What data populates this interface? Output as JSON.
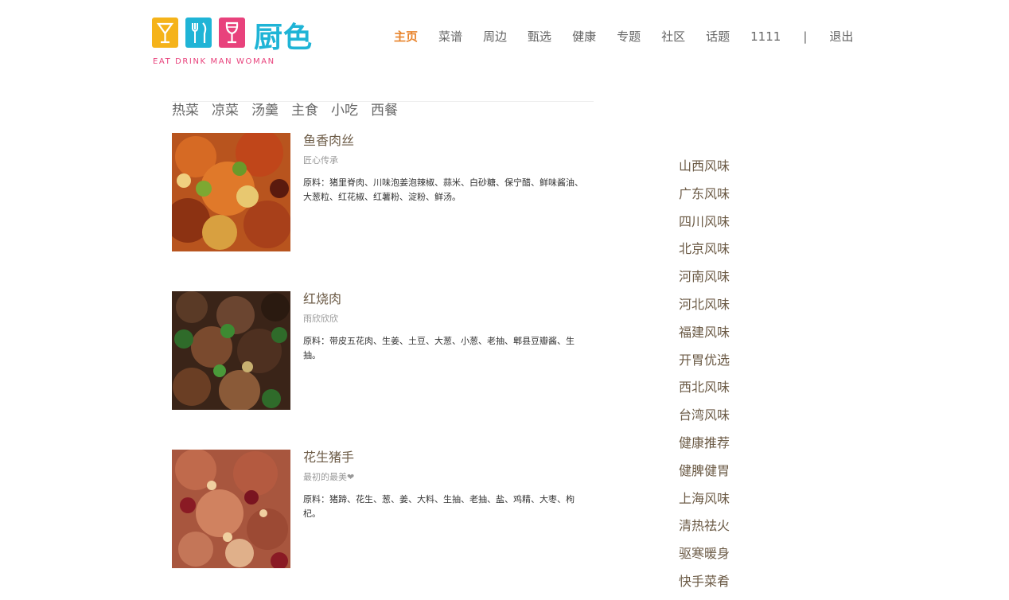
{
  "brand": {
    "name": "厨色",
    "slogan": "EAT DRINK MAN WOMAN",
    "colors": {
      "yellow": "#f5b31a",
      "cyan": "#1fb4d6",
      "pink": "#e8427c"
    },
    "icons": [
      "cocktail-glass-icon",
      "fork-knife-icon",
      "wine-glass-icon"
    ]
  },
  "nav": {
    "items": [
      {
        "label": "主页",
        "active": true
      },
      {
        "label": "菜谱"
      },
      {
        "label": "周边"
      },
      {
        "label": "甄选"
      },
      {
        "label": "健康"
      },
      {
        "label": "专题"
      },
      {
        "label": "社区"
      },
      {
        "label": "话题"
      },
      {
        "label": "1111"
      }
    ],
    "separator": "|",
    "logout": "退出",
    "active_color": "#e8842c"
  },
  "categories": [
    "热菜",
    "凉菜",
    "汤羹",
    "主食",
    "小吃",
    "西餐"
  ],
  "recipes": [
    {
      "title": "鱼香肉丝",
      "author": "匠心传承",
      "ingredients": "原料：猪里脊肉、川味泡姜泡辣椒、蒜米、白砂糖、保宁醋、鲜味酱油、大葱粒、红花椒、红薯粉、淀粉、鲜汤。"
    },
    {
      "title": "红烧肉",
      "author": "雨欣欣欣",
      "ingredients": "原料：带皮五花肉、生姜、土豆、大葱、小葱、老抽、郫县豆瓣酱、生抽。"
    },
    {
      "title": "花生猪手",
      "author": "最初的最美❤",
      "ingredients": "原料：猪蹄、花生、葱、姜、大料、生抽、老抽、盐、鸡精、大枣、枸杞。"
    }
  ],
  "flavors": [
    "山西风味",
    "广东风味",
    "四川风味",
    "北京风味",
    "河南风味",
    "河北风味",
    "福建风味",
    "开胃优选",
    "西北风味",
    "台湾风味",
    "健康推荐",
    "健脾健胃",
    "上海风味",
    "清热祛火",
    "驱寒暖身",
    "快手菜肴"
  ]
}
